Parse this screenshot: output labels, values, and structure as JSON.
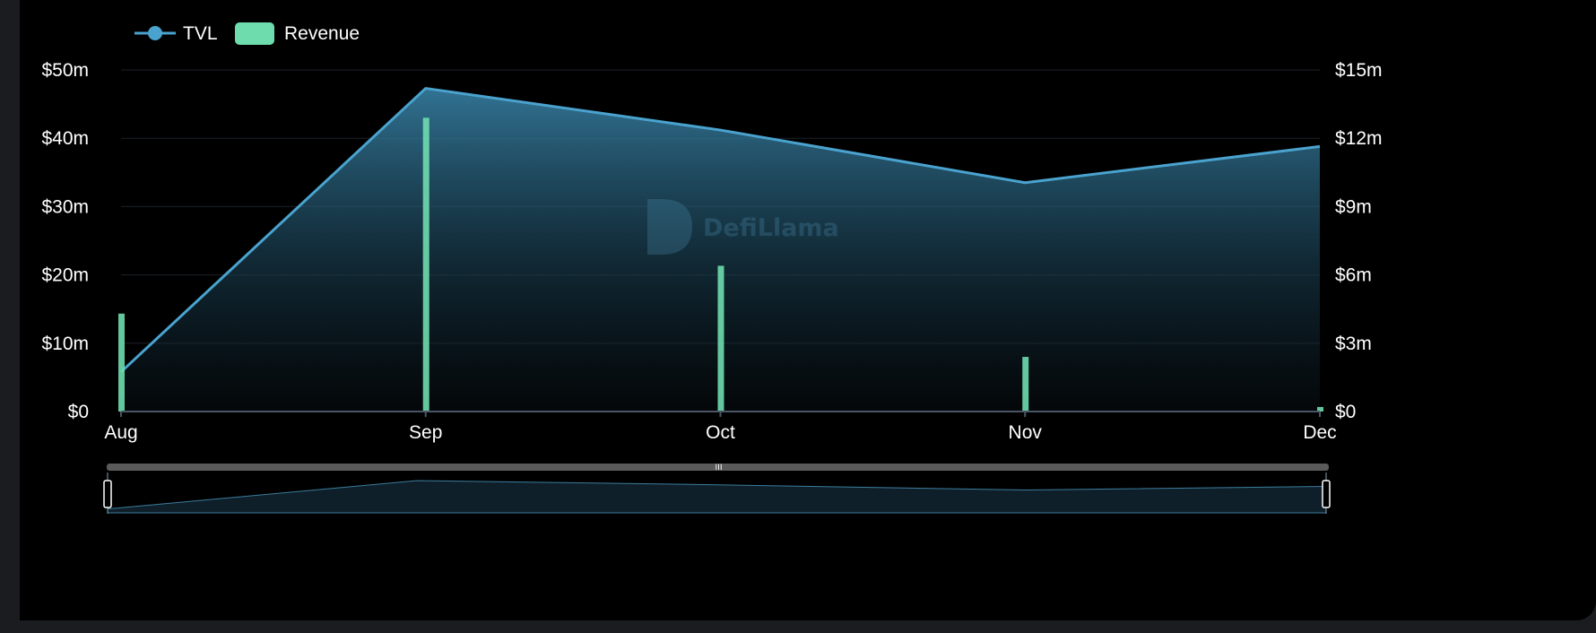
{
  "legend": {
    "tvl_label": "TVL",
    "revenue_label": "Revenue"
  },
  "watermark": "DefiLlama",
  "colors": {
    "tvl_line": "#4aa3cf",
    "revenue_bar": "#6fdcae",
    "grid": "#1c2128",
    "axis": "#4a5566",
    "watermark": "#2c4a5a",
    "slider_handle_fill": "#000000",
    "slider_bar": "#5a5a5a"
  },
  "chart_data": {
    "type": "line",
    "x": [
      "2024-08-01",
      "2024-09-01",
      "2024-10-01",
      "2024-11-01",
      "2024-12-01"
    ],
    "x_tick_labels": [
      "Aug",
      "Sep",
      "Oct",
      "Nov",
      "Dec"
    ],
    "series": [
      {
        "name": "TVL",
        "type": "area",
        "axis": "left",
        "x": [
          "2024-08-01",
          "2024-09-01",
          "2024-10-01",
          "2024-11-01",
          "2024-12-01"
        ],
        "values": [
          5800000,
          47300000,
          41200000,
          33500000,
          38800000
        ]
      },
      {
        "name": "Revenue",
        "type": "bar",
        "axis": "right",
        "x": [
          "2024-08-01",
          "2024-09-01",
          "2024-10-01",
          "2024-11-01",
          "2024-12-01"
        ],
        "values": [
          4300000,
          12900000,
          6400000,
          2400000,
          200000
        ]
      }
    ],
    "y_left": {
      "ylim": [
        0,
        50000000
      ],
      "ticks": [
        0,
        10000000,
        20000000,
        30000000,
        40000000,
        50000000
      ],
      "tick_labels": [
        "$0",
        "$10m",
        "$20m",
        "$30m",
        "$40m",
        "$50m"
      ]
    },
    "y_right": {
      "ylim": [
        0,
        15000000
      ],
      "ticks": [
        0,
        3000000,
        6000000,
        9000000,
        12000000,
        15000000
      ],
      "tick_labels": [
        "$0",
        "$3m",
        "$6m",
        "$9m",
        "$12m",
        "$15m"
      ]
    },
    "grid": true,
    "legend_position": "top-left",
    "zoom_slider": true
  }
}
